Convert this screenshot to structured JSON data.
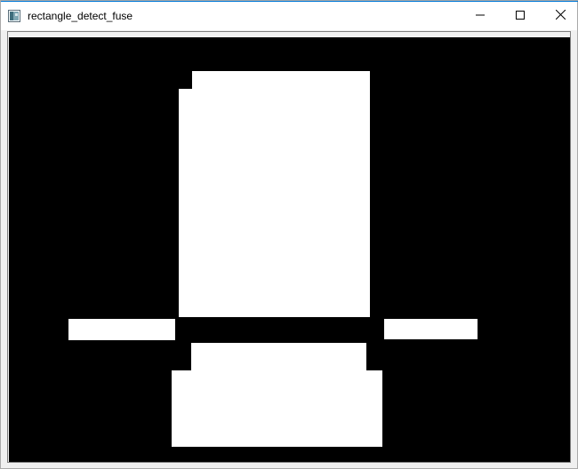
{
  "window": {
    "title": "rectangle_detect_fuse",
    "accent_color": "#0078d7"
  },
  "title_bar": {
    "icon": "image-window-icon",
    "controls": [
      {
        "name": "minimize",
        "icon": "minimize-icon"
      },
      {
        "name": "maximize",
        "icon": "maximize-icon"
      },
      {
        "name": "close",
        "icon": "close-icon"
      }
    ]
  },
  "canvas": {
    "background": "#000000",
    "foreground": "#ffffff",
    "content": "binary mask with white rectangular regions"
  }
}
